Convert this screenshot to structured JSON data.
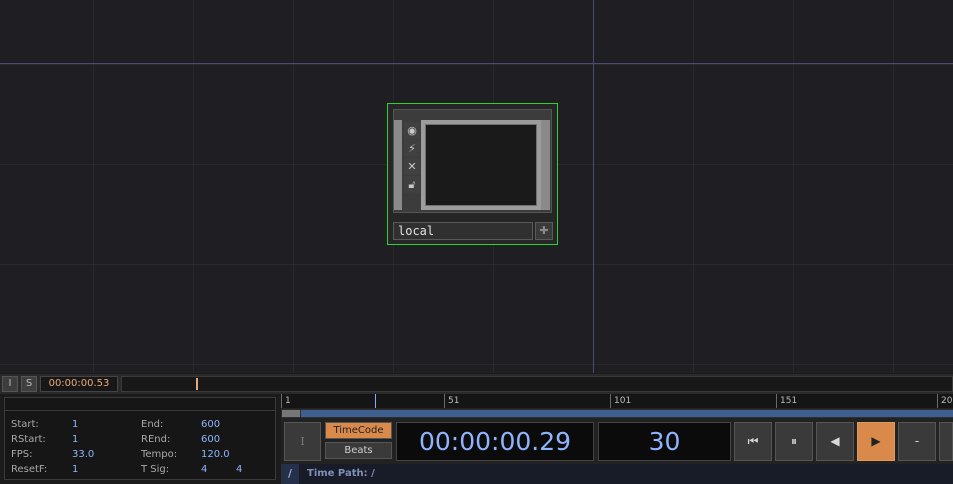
{
  "network": {
    "node": {
      "name": "local"
    }
  },
  "strip": {
    "i_label": "I",
    "s_label": "S",
    "time": "00:00:00.53"
  },
  "settings": {
    "start_label": "Start:",
    "start_value": "1",
    "end_label": "End:",
    "end_value": "600",
    "rstart_label": "RStart:",
    "rstart_value": "1",
    "rend_label": "REnd:",
    "rend_value": "600",
    "fps_label": "FPS:",
    "fps_value": "33.0",
    "tempo_label": "Tempo:",
    "tempo_value": "120.0",
    "resetf_label": "ResetF:",
    "resetf_value": "1",
    "tsig_label": "T Sig:",
    "tsig_num": "4",
    "tsig_den": "4"
  },
  "transport": {
    "ruler_ticks": [
      "1",
      "51",
      "101",
      "151",
      "20"
    ],
    "i_button": "I",
    "timecode_label": "TimeCode",
    "beats_label": "Beats",
    "timecode_value": "00:00:00.29",
    "frame_value": "30",
    "minus_label": "-",
    "timepath_slash": "/",
    "timepath_label": "Time Path: /"
  },
  "colors": {
    "accent_orange": "#d98a4a",
    "value_blue": "#8fb4ff",
    "node_selected_green": "#2fd12f"
  },
  "icons": {
    "node_icons": [
      "viewer-active-icon",
      "bypass-icon",
      "close-icon",
      "lock-icon"
    ],
    "transport": [
      "rewind-icon",
      "pause-icon",
      "step-back-icon",
      "play-icon"
    ]
  }
}
